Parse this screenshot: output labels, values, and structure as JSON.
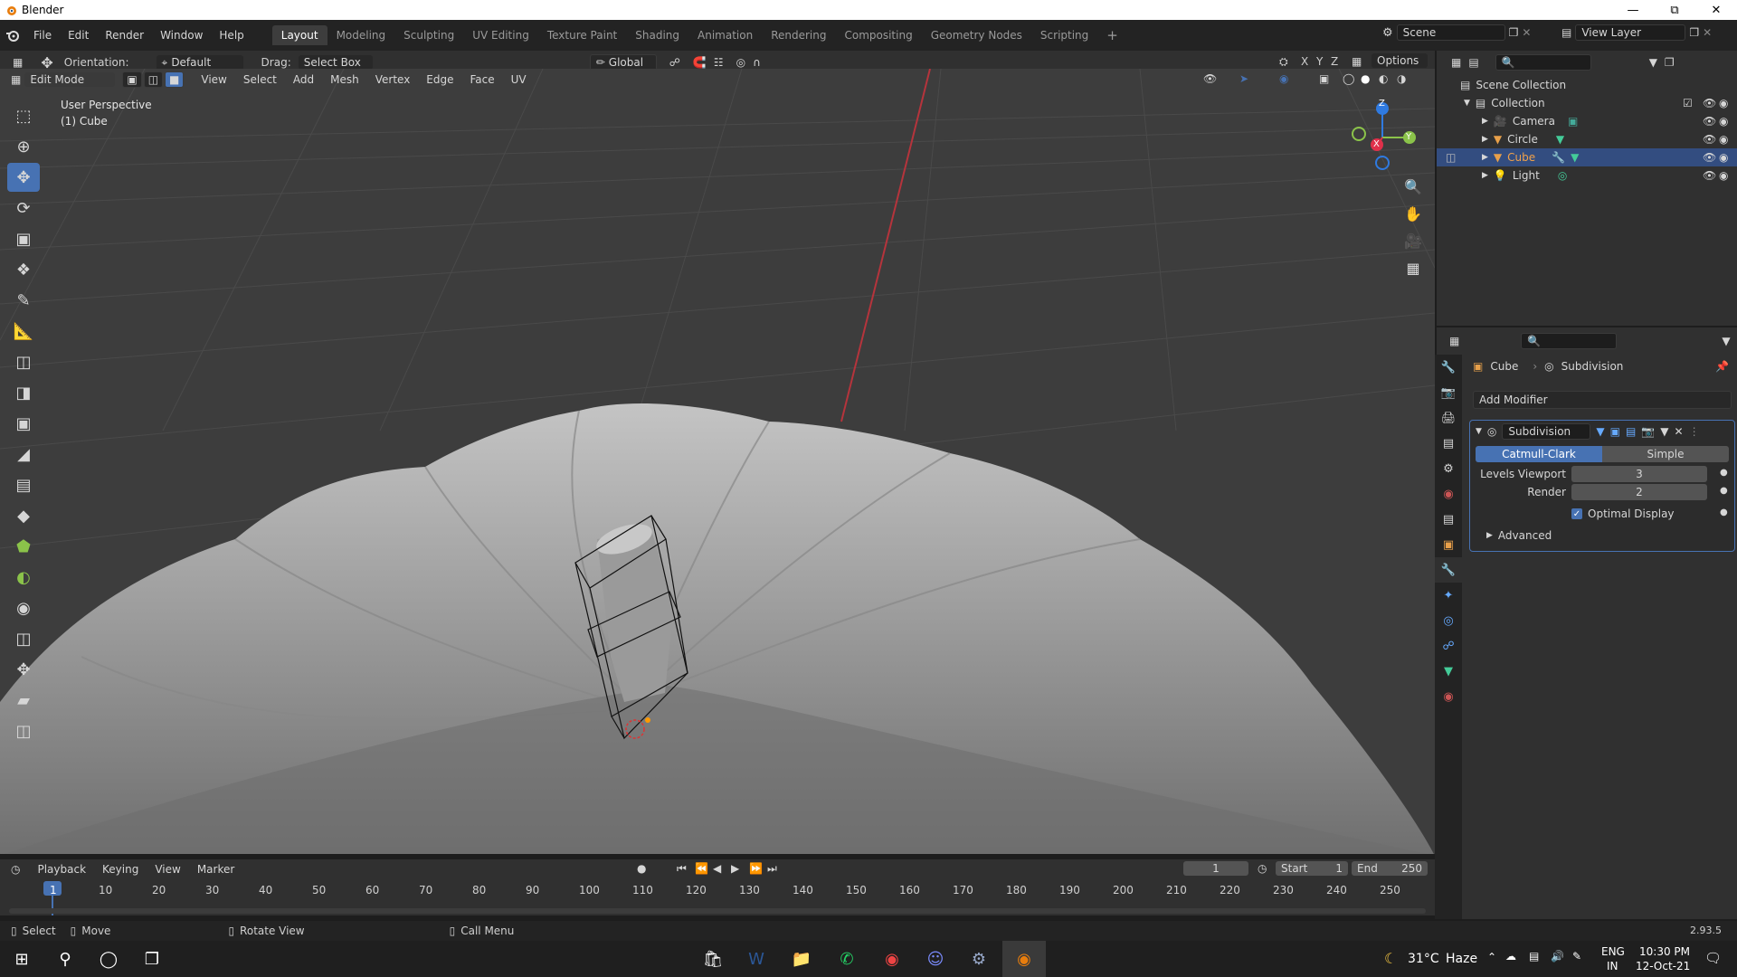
{
  "window": {
    "title": "Blender"
  },
  "menu": {
    "items": [
      "File",
      "Edit",
      "Render",
      "Window",
      "Help"
    ]
  },
  "workspaces": {
    "tabs": [
      "Layout",
      "Modeling",
      "Sculpting",
      "UV Editing",
      "Texture Paint",
      "Shading",
      "Animation",
      "Rendering",
      "Compositing",
      "Geometry Nodes",
      "Scripting"
    ],
    "active": "Layout",
    "add": "+"
  },
  "scene": {
    "label": "Scene",
    "view_layer": "View Layer"
  },
  "toolheader": {
    "orientation_label": "Orientation:",
    "orientation_value": "Default",
    "drag_label": "Drag:",
    "drag_value": "Select Box",
    "transform_space": "Global",
    "axes": [
      "X",
      "Y",
      "Z"
    ],
    "options": "Options"
  },
  "editheader": {
    "mode": "Edit Mode",
    "menus": [
      "View",
      "Select",
      "Add",
      "Mesh",
      "Vertex",
      "Edge",
      "Face",
      "UV"
    ]
  },
  "viewport": {
    "perspective": "User Perspective",
    "object": "(1) Cube",
    "gizmo": {
      "x": "X",
      "y": "Y",
      "z": "Z"
    }
  },
  "outliner": {
    "root": "Scene Collection",
    "collection": "Collection",
    "items": [
      {
        "name": "Camera",
        "selected": false
      },
      {
        "name": "Circle",
        "selected": false
      },
      {
        "name": "Cube",
        "selected": true
      },
      {
        "name": "Light",
        "selected": false
      }
    ]
  },
  "properties": {
    "breadcrumb_object": "Cube",
    "breadcrumb_modifier": "Subdivision",
    "add_modifier": "Add Modifier",
    "modifier_name": "Subdivision",
    "type_options": [
      "Catmull-Clark",
      "Simple"
    ],
    "type_selected": "Catmull-Clark",
    "levels_viewport_label": "Levels Viewport",
    "levels_viewport_value": "3",
    "render_label": "Render",
    "render_value": "2",
    "optimal_display_label": "Optimal Display",
    "optimal_display_checked": true,
    "advanced_label": "Advanced"
  },
  "timeline": {
    "menus": [
      "Playback",
      "Keying",
      "View",
      "Marker"
    ],
    "current_frame": "1",
    "start_label": "Start",
    "start_value": "1",
    "end_label": "End",
    "end_value": "250",
    "ticks": [
      "1",
      "10",
      "20",
      "30",
      "40",
      "50",
      "60",
      "70",
      "80",
      "90",
      "100",
      "110",
      "120",
      "130",
      "140",
      "150",
      "160",
      "170",
      "180",
      "190",
      "200",
      "210",
      "220",
      "230",
      "240",
      "250"
    ]
  },
  "statusbar": {
    "select": "Select",
    "move": "Move",
    "rotate": "Rotate View",
    "call_menu": "Call Menu",
    "version": "2.93.5"
  },
  "taskbar": {
    "temperature": "31°C",
    "weather": "Haze",
    "language": "ENG",
    "region": "IN",
    "time": "10:30 PM",
    "date": "12-Oct-21"
  },
  "colors": {
    "accent": "#4772b3",
    "selected_row": "#334d80",
    "viewport_bg": "#3d3d3d",
    "panel_bg": "#303030",
    "x_axis": "#e0304a",
    "y_axis": "#8bc34a",
    "z_axis": "#2f7ae0"
  }
}
